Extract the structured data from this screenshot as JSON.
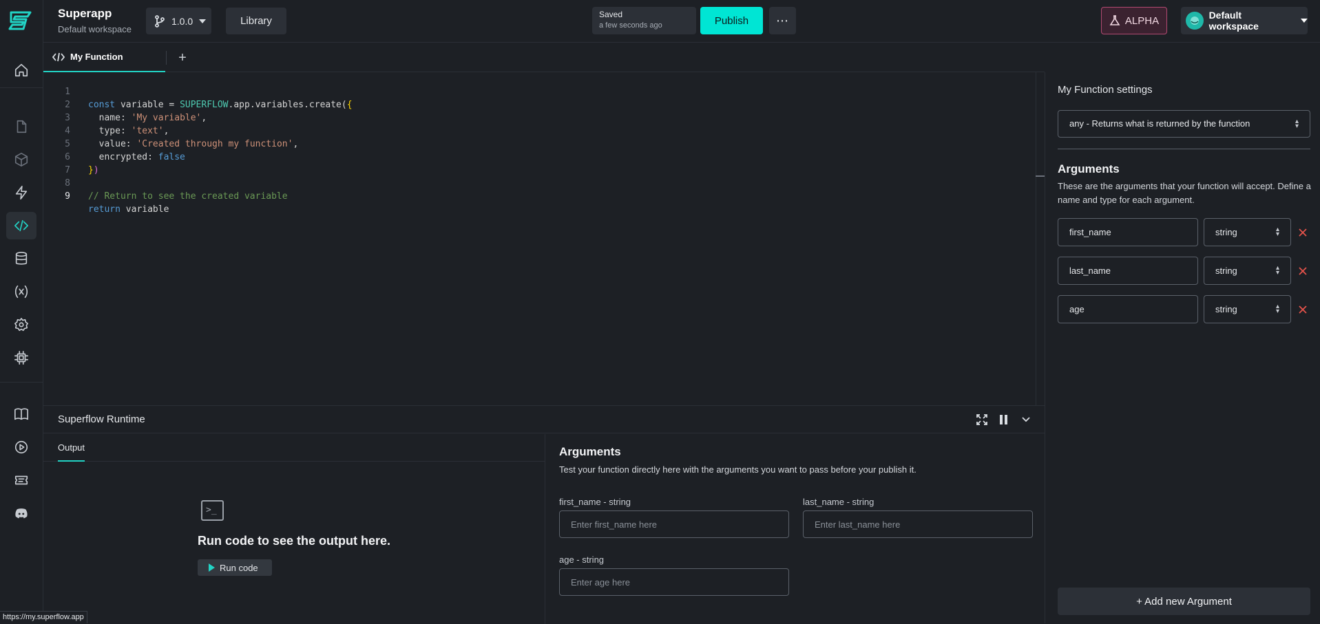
{
  "colors": {
    "accent": "#00e5d4",
    "alpha_border": "#b34a72",
    "delete": "#e5534b"
  },
  "header": {
    "app_name": "Superapp",
    "workspace_sub": "Default workspace",
    "version": "1.0.0",
    "library_label": "Library",
    "saved_title": "Saved",
    "saved_time": "a few seconds ago",
    "publish_label": "Publish",
    "more_label": "⋯",
    "alpha_label": "ALPHA",
    "workspace_label": "Default workspace"
  },
  "sidebar": {
    "icons": [
      "home-icon",
      "file-icon",
      "cube-icon",
      "lightning-icon",
      "code-icon",
      "database-icon",
      "variable-icon",
      "gear-icon",
      "chip-icon",
      "book-icon",
      "play-circle-icon",
      "ticket-icon",
      "discord-icon"
    ],
    "active": "code-icon"
  },
  "editor": {
    "tab_label": "My Function",
    "lines": [
      {
        "n": "1"
      },
      {
        "n": "2"
      },
      {
        "n": "3"
      },
      {
        "n": "4"
      },
      {
        "n": "5"
      },
      {
        "n": "6"
      },
      {
        "n": "7"
      },
      {
        "n": "8"
      },
      {
        "n": "9"
      }
    ],
    "code": {
      "l1_kw": "const",
      "l1_a": " variable = ",
      "l1_sf": "SUPERFLOW",
      "l1_b": ".app.variables.create(",
      "l1_br": "{",
      "l2_a": "  name: ",
      "l2_s": "'My variable'",
      "l2_b": ",",
      "l3_a": "  type: ",
      "l3_s": "'text'",
      "l3_b": ",",
      "l4_a": "  value: ",
      "l4_s": "'Created through my function'",
      "l4_b": ",",
      "l5_a": "  encrypted: ",
      "l5_kw": "false",
      "l6_br": "}",
      "l6_br2": ")",
      "l8_cmt": "// Return to see the created variable",
      "l9_kw": "return",
      "l9_a": " variable"
    }
  },
  "runtime": {
    "title": "Superflow Runtime",
    "output_tab": "Output",
    "run_hint": "Run code to see the output here.",
    "run_button": "Run code",
    "args_title": "Arguments",
    "args_desc": "Test your function directly here with the arguments you want to pass before your publish it.",
    "fields": [
      {
        "label": "first_name - string",
        "placeholder": "Enter first_name here"
      },
      {
        "label": "last_name - string",
        "placeholder": "Enter last_name here"
      },
      {
        "label": "age - string",
        "placeholder": "Enter age here"
      }
    ]
  },
  "settings": {
    "title": "My Function settings",
    "return_type": "any - Returns what is returned by the function",
    "args_title": "Arguments",
    "args_desc": "These are the arguments that your function will accept. Define a name and type for each argument.",
    "arguments": [
      {
        "name": "first_name",
        "type": "string"
      },
      {
        "name": "last_name",
        "type": "string"
      },
      {
        "name": "age",
        "type": "string"
      }
    ],
    "add_button": "+ Add new Argument"
  },
  "status_url": "https://my.superflow.app"
}
